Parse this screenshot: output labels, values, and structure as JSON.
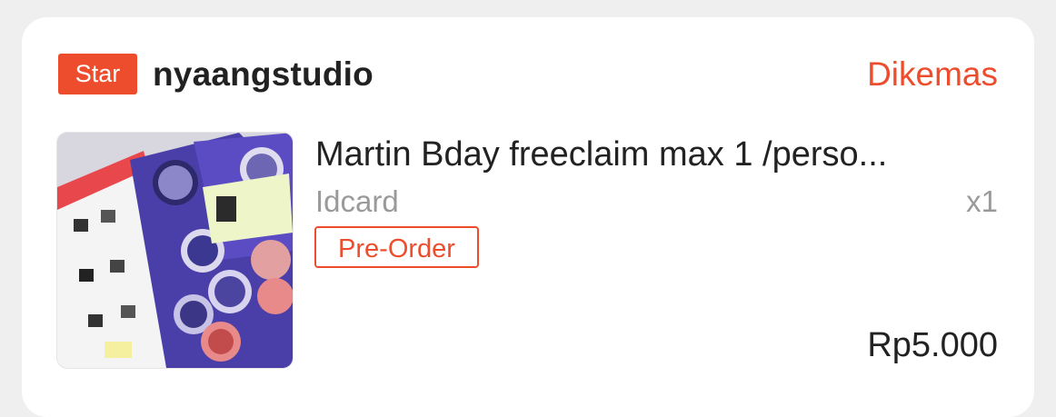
{
  "order": {
    "badge": "Star",
    "shop_name": "nyaangstudio",
    "status": "Dikemas",
    "status_color": "#ee4d2d",
    "item": {
      "title": "Martin Bday freeclaim max 1 /perso...",
      "variant": "Idcard",
      "quantity": "x1",
      "tag": "Pre-Order",
      "price": "Rp5.000",
      "image_icon": "product-photo"
    }
  }
}
